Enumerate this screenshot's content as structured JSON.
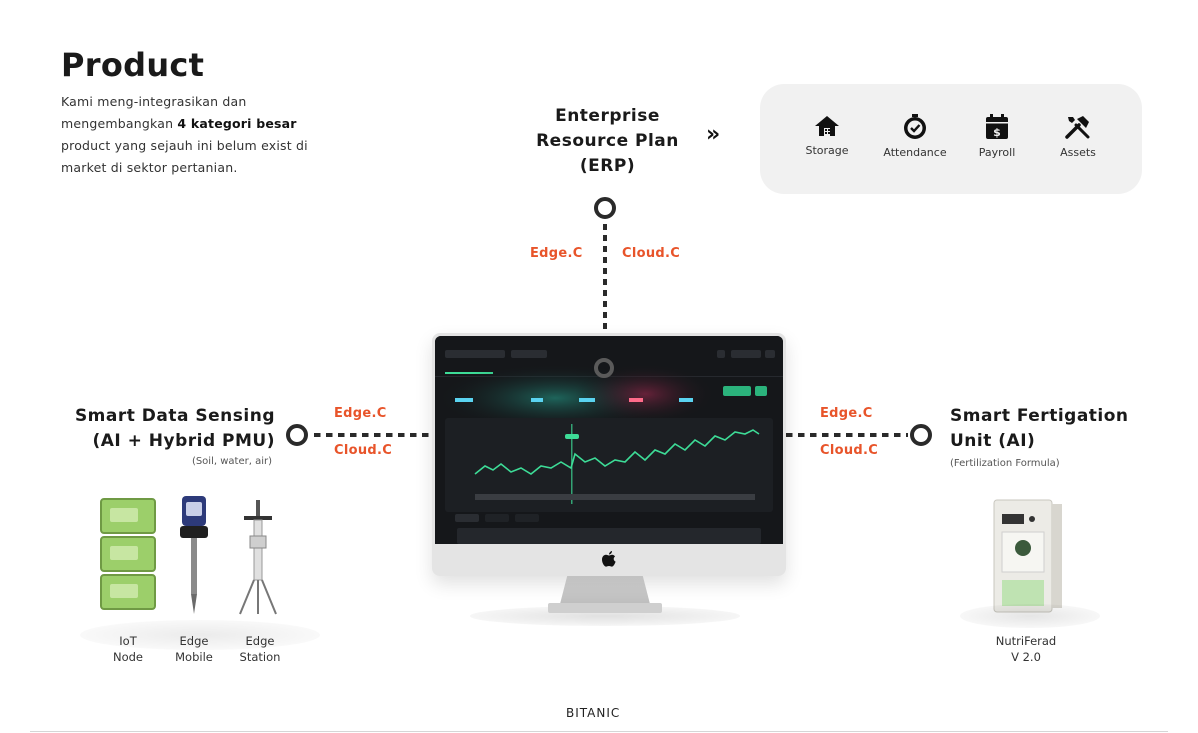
{
  "header": {
    "title": "Product",
    "intro_part1": "Kami meng-integrasikan dan mengembangkan ",
    "intro_bold": "4 kategori besar",
    "intro_part2": " product yang sejauh ini belum exist di market di sektor pertanian."
  },
  "erp": {
    "title": "Enterprise Resource Plan (ERP)",
    "chevron": "»",
    "modules": [
      {
        "label": "Storage",
        "icon": "storage-home-icon"
      },
      {
        "label": "Attendance",
        "icon": "attendance-check-icon"
      },
      {
        "label": "Payroll",
        "icon": "payroll-calendar-icon"
      },
      {
        "label": "Assets",
        "icon": "assets-tools-icon"
      }
    ]
  },
  "connectors": {
    "top_left": "Edge.C",
    "top_right": "Cloud.C",
    "left_top": "Edge.C",
    "left_bottom": "Cloud.C",
    "right_top": "Edge.C",
    "right_bottom": "Cloud.C"
  },
  "sensing": {
    "title_line1": "Smart Data Sensing",
    "title_line2": "(AI + Hybrid PMU)",
    "subtitle": "(Soil, water, air)",
    "devices": [
      {
        "line1": "IoT",
        "line2": "Node"
      },
      {
        "line1": "Edge",
        "line2": "Mobile"
      },
      {
        "line1": "Edge",
        "line2": "Station"
      }
    ]
  },
  "fertigation": {
    "title_line1": "Smart Fertigation",
    "title_line2": "Unit (AI)",
    "subtitle": "(Fertilization Formula)",
    "device": {
      "line1": "NutriFerad",
      "line2": "V 2.0"
    }
  },
  "footer": {
    "brand": "BITANIC"
  },
  "colors": {
    "accent": "#e8542a",
    "panel": "#f1f1f1",
    "dashboard_line": "#3ddc97"
  }
}
